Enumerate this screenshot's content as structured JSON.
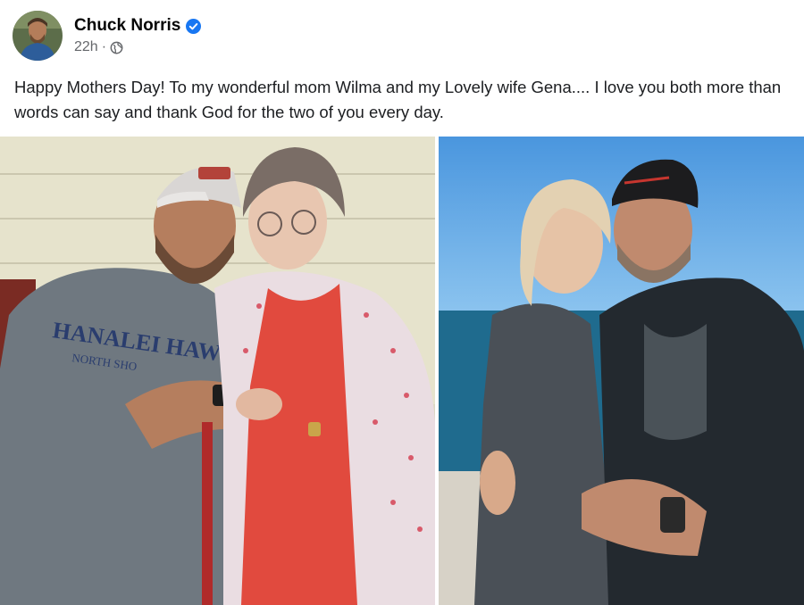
{
  "post": {
    "author": "Chuck Norris",
    "verified": true,
    "time": "22h",
    "separator": "·",
    "audience_icon": "globe-icon",
    "caption": "Happy Mothers Day! To my wonderful mom Wilma and my Lovely wife Gena.... I love you both more than words can say and thank God for the two of you every day.",
    "photos": [
      {
        "subject": "photo-mother",
        "shirt_text": "HANALEI HAW",
        "shirt_subtext": "NORTH SHO"
      },
      {
        "subject": "photo-wife"
      }
    ]
  },
  "colors": {
    "verified_badge": "#1877f2",
    "secondary_text": "#65676b",
    "primary_text": "#050505"
  }
}
